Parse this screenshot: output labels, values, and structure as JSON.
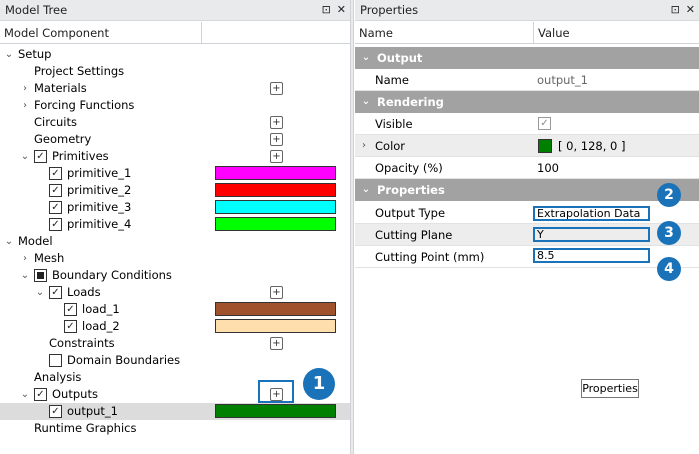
{
  "left_panel": {
    "title": "Model Tree",
    "col_component": "Model Component",
    "pin": "⊡",
    "close": "✕",
    "tree": [
      {
        "label": "Setup",
        "indent": 0,
        "chevron": "open"
      },
      {
        "label": "Project Settings",
        "indent": 1
      },
      {
        "label": "Materials",
        "indent": 1,
        "chevron": "closed",
        "plus": true
      },
      {
        "label": "Forcing Functions",
        "indent": 1,
        "chevron": "closed"
      },
      {
        "label": "Circuits",
        "indent": 1,
        "plus": true
      },
      {
        "label": "Geometry",
        "indent": 1,
        "plus": true
      },
      {
        "label": "Primitives",
        "indent": 1,
        "chevron": "open",
        "check": "checked",
        "plus": true
      },
      {
        "label": "primitive_1",
        "indent": 2,
        "check": "checked",
        "color": "#ff00ff"
      },
      {
        "label": "primitive_2",
        "indent": 2,
        "check": "checked",
        "color": "#ff0000"
      },
      {
        "label": "primitive_3",
        "indent": 2,
        "check": "checked",
        "color": "#00ffff"
      },
      {
        "label": "primitive_4",
        "indent": 2,
        "check": "checked",
        "color": "#00ff00"
      },
      {
        "label": "Model",
        "indent": 0,
        "chevron": "open"
      },
      {
        "label": "Mesh",
        "indent": 1,
        "chevron": "closed"
      },
      {
        "label": "Boundary Conditions",
        "indent": 1,
        "chevron": "open",
        "check": "partial"
      },
      {
        "label": "Loads",
        "indent": 2,
        "chevron": "open",
        "check": "checked",
        "plus": true
      },
      {
        "label": "load_1",
        "indent": 3,
        "check": "checked",
        "color": "#a0522d"
      },
      {
        "label": "load_2",
        "indent": 3,
        "check": "checked",
        "color": "#ffdead"
      },
      {
        "label": "Constraints",
        "indent": 2,
        "plus": true
      },
      {
        "label": "Domain Boundaries",
        "indent": 2,
        "check": "unchecked"
      },
      {
        "label": "Analysis",
        "indent": 1
      },
      {
        "label": "Outputs",
        "indent": 1,
        "chevron": "open",
        "check": "checked",
        "plus": true,
        "highlight": true
      },
      {
        "label": "output_1",
        "indent": 2,
        "check": "checked",
        "color": "#008000",
        "selected": true
      },
      {
        "label": "Runtime Graphics",
        "indent": 1
      }
    ]
  },
  "right_panel": {
    "title": "Properties",
    "col_name": "Name",
    "col_value": "Value",
    "pin": "⊡",
    "close": "✕",
    "sections": {
      "output": "Output",
      "rendering": "Rendering",
      "properties": "Properties"
    },
    "name_label": "Name",
    "name_value": "output_1",
    "visible_label": "Visible",
    "color_label": "Color",
    "color_value": "[ 0, 128, 0 ]",
    "color_swatch": "#008000",
    "opacity_label": "Opacity (%)",
    "opacity_value": "100",
    "output_type_label": "Output Type",
    "output_type_value": "Extrapolation Data",
    "cutting_plane_label": "Cutting Plane",
    "cutting_plane_value": "Y",
    "cutting_point_label": "Cutting Point (mm)",
    "cutting_point_value": "8.5",
    "tooltip": "Properties"
  },
  "badges": [
    "1",
    "2",
    "3",
    "4"
  ],
  "colors": {
    "accent": "#1a73b8",
    "section": "#a2a2a2"
  }
}
